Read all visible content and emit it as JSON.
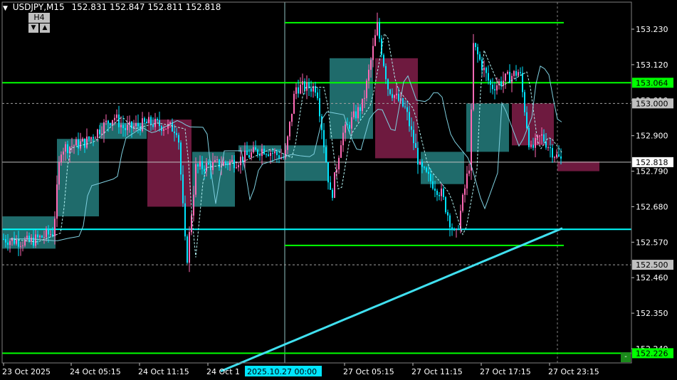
{
  "header": {
    "symbol_tf": "USDJPY,M15",
    "ohlc": "152.831 152.847 152.811 152.818"
  },
  "timeframe_widget": {
    "label": "H4",
    "down": "▼",
    "up": "▲"
  },
  "price_axis": {
    "min": 152.17,
    "max": 153.33,
    "ticks": [
      "153.230",
      "153.120",
      "153.010",
      "152.900",
      "152.790",
      "152.680",
      "152.570",
      "152.460",
      "152.350",
      "152.240"
    ]
  },
  "price_labels": [
    {
      "value": 153.064,
      "text": "153.064",
      "bg": "#00ff00",
      "fg": "#000000"
    },
    {
      "value": 153.0,
      "text": "153.000",
      "bg": "#c0c0c0",
      "fg": "#000000"
    },
    {
      "value": 152.818,
      "text": "152.818",
      "bg": "#ffffff",
      "fg": "#000000"
    },
    {
      "value": 152.5,
      "text": "152.500",
      "bg": "#c0c0c0",
      "fg": "#000000"
    },
    {
      "value": 152.226,
      "text": "152.226",
      "bg": "#00ff00",
      "fg": "#000000"
    }
  ],
  "time_axis": {
    "labels": [
      "23 Oct 2025",
      "24 Oct 05:15",
      "24 Oct 11:15",
      "24 Oct 1",
      "27 Oct 05:15",
      "27 Oct 11:15",
      "27 Oct 17:15",
      "27 Oct 23:15"
    ],
    "cursor_label": "2025.10.27 00:00"
  },
  "levels": {
    "h_green_long": [
      153.064,
      152.226
    ],
    "h_green_short": [
      153.25,
      152.56
    ],
    "h_cyan": 152.61,
    "dashed": [
      153.0,
      152.5
    ],
    "bid": 152.818
  },
  "colors": {
    "bull_candle": "#ff69b4",
    "bear_candle": "#00e5ff",
    "h4_bull_box": "#1f6b6b",
    "h4_bear_box": "#6e1a3f",
    "level_green": "#00ff00",
    "level_cyan": "#00ffff",
    "ma_slow": "#40e0f0"
  },
  "chart_data": {
    "type": "candlestick",
    "title": "USDJPY,M15",
    "ylim": [
      152.17,
      153.33
    ],
    "h4_boxes": [
      {
        "open": 152.55,
        "close": 152.65,
        "bull": true
      },
      {
        "open": 152.65,
        "close": 152.89,
        "bull": true
      },
      {
        "open": 152.89,
        "close": 152.94,
        "bull": true
      },
      {
        "open": 152.95,
        "close": 152.68,
        "bull": false
      },
      {
        "open": 152.68,
        "close": 152.85,
        "bull": true
      },
      {
        "open": 152.85,
        "close": 152.87,
        "bull": true
      },
      {
        "open": 152.76,
        "close": 152.87,
        "bull": true
      },
      {
        "open": 152.89,
        "close": 153.14,
        "bull": true
      },
      {
        "open": 153.14,
        "close": 152.83,
        "bull": false
      },
      {
        "open": 152.75,
        "close": 152.85,
        "bull": true
      },
      {
        "open": 152.85,
        "close": 153.0,
        "bull": true
      },
      {
        "open": 153.0,
        "close": 152.87,
        "bull": false
      },
      {
        "open": 152.82,
        "close": 152.79,
        "bull": false
      }
    ]
  }
}
